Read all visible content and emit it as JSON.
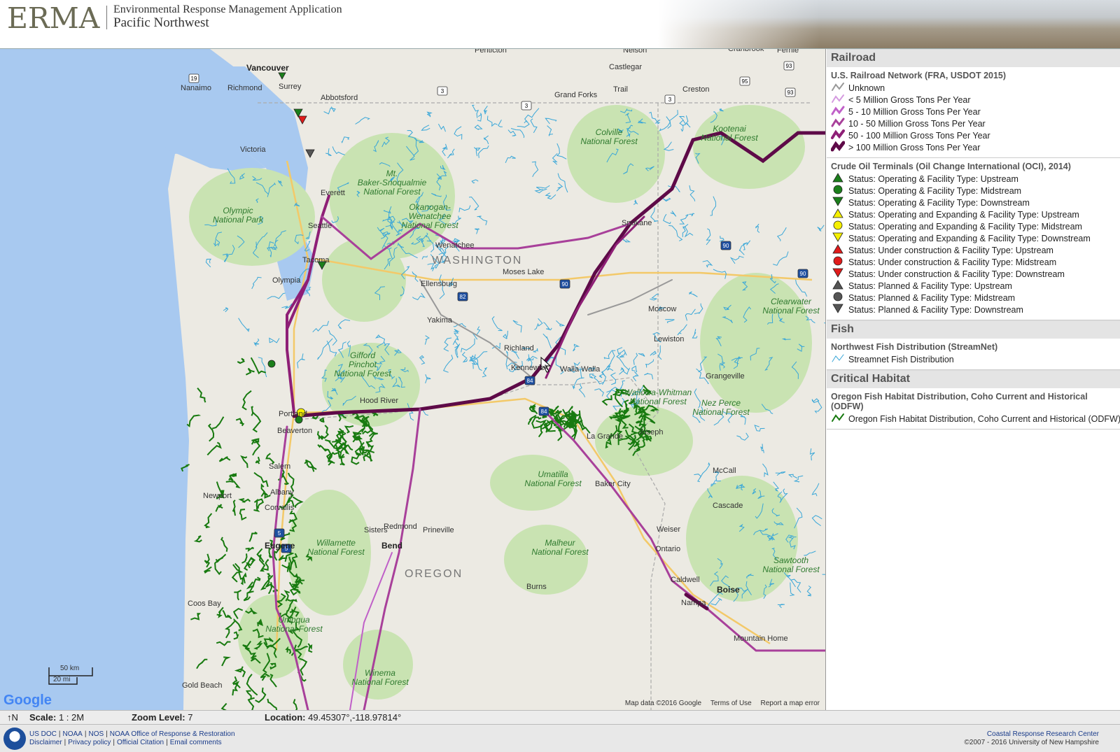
{
  "header": {
    "logo": "ERMA",
    "title": "Environmental Response Management Application",
    "region": "Pacific Northwest"
  },
  "map": {
    "places": [
      {
        "label": "Vancouver",
        "cls": "city",
        "key": "vancouver"
      },
      {
        "label": "Nanaimo",
        "cls": "place",
        "key": "nanaimo"
      },
      {
        "label": "Richmond",
        "cls": "place",
        "key": "richmond"
      },
      {
        "label": "Surrey",
        "cls": "place",
        "key": "surrey"
      },
      {
        "label": "Abbotsford",
        "cls": "place",
        "key": "abbotsford"
      },
      {
        "label": "Victoria",
        "cls": "place",
        "key": "victoria"
      },
      {
        "label": "Penticton",
        "cls": "place",
        "key": "penticton"
      },
      {
        "label": "Nelson",
        "cls": "place",
        "key": "nelson"
      },
      {
        "label": "Castlegar",
        "cls": "place",
        "key": "castlegar"
      },
      {
        "label": "Cranbrook",
        "cls": "place",
        "key": "cranbrook"
      },
      {
        "label": "Fernie",
        "cls": "place",
        "key": "fernie"
      },
      {
        "label": "Grand Forks",
        "cls": "place",
        "key": "grandforks"
      },
      {
        "label": "Trail",
        "cls": "place",
        "key": "trail"
      },
      {
        "label": "Creston",
        "cls": "place",
        "key": "creston"
      },
      {
        "label": "Everett",
        "cls": "place",
        "key": "everett"
      },
      {
        "label": "Seattle",
        "cls": "place",
        "key": "seattle"
      },
      {
        "label": "Tacoma",
        "cls": "place",
        "key": "tacoma"
      },
      {
        "label": "Olympia",
        "cls": "place",
        "key": "olympia"
      },
      {
        "label": "Wenatchee",
        "cls": "place",
        "key": "wenatchee"
      },
      {
        "label": "Moses Lake",
        "cls": "place",
        "key": "moseslake"
      },
      {
        "label": "Ellensburg",
        "cls": "place",
        "key": "ellensburg"
      },
      {
        "label": "Yakima",
        "cls": "place",
        "key": "yakima"
      },
      {
        "label": "Spokane",
        "cls": "place",
        "key": "spokane"
      },
      {
        "label": "Moscow",
        "cls": "place",
        "key": "moscow"
      },
      {
        "label": "Lewiston",
        "cls": "place",
        "key": "lewiston"
      },
      {
        "label": "Richland",
        "cls": "place",
        "key": "richland"
      },
      {
        "label": "Kennewick",
        "cls": "place",
        "key": "kennewick"
      },
      {
        "label": "Walla Walla",
        "cls": "place",
        "key": "wallawalla"
      },
      {
        "label": "Grangeville",
        "cls": "place",
        "key": "grangeville"
      },
      {
        "label": "Hood River",
        "cls": "place",
        "key": "hoodriver"
      },
      {
        "label": "Portland",
        "cls": "place",
        "key": "portland"
      },
      {
        "label": "Beaverton",
        "cls": "place",
        "key": "beaverton"
      },
      {
        "label": "Salem",
        "cls": "place",
        "key": "salem"
      },
      {
        "label": "Albany",
        "cls": "place",
        "key": "albany"
      },
      {
        "label": "Corvallis",
        "cls": "place",
        "key": "corvallis"
      },
      {
        "label": "Newport",
        "cls": "place",
        "key": "newport"
      },
      {
        "label": "La Grande",
        "cls": "place",
        "key": "lagrande"
      },
      {
        "label": "Joseph",
        "cls": "place",
        "key": "joseph"
      },
      {
        "label": "Baker City",
        "cls": "place",
        "key": "bakercity"
      },
      {
        "label": "McCall",
        "cls": "place",
        "key": "mccall"
      },
      {
        "label": "Cascade",
        "cls": "place",
        "key": "cascade"
      },
      {
        "label": "Sisters",
        "cls": "place",
        "key": "sisters"
      },
      {
        "label": "Redmond",
        "cls": "place",
        "key": "redmond"
      },
      {
        "label": "Prineville",
        "cls": "place",
        "key": "prineville"
      },
      {
        "label": "Bend",
        "cls": "city",
        "key": "bend"
      },
      {
        "label": "Eugene",
        "cls": "city",
        "key": "eugene"
      },
      {
        "label": "Weiser",
        "cls": "place",
        "key": "weiser"
      },
      {
        "label": "Ontario",
        "cls": "place",
        "key": "ontario"
      },
      {
        "label": "Caldwell",
        "cls": "place",
        "key": "caldwell"
      },
      {
        "label": "Nampa",
        "cls": "place",
        "key": "nampa"
      },
      {
        "label": "Boise",
        "cls": "city",
        "key": "boise"
      },
      {
        "label": "Mountain Home",
        "cls": "place",
        "key": "mountainhome"
      },
      {
        "label": "Burns",
        "cls": "place",
        "key": "burns"
      },
      {
        "label": "Coos Bay",
        "cls": "place",
        "key": "coosbay"
      },
      {
        "label": "Gold Beach",
        "cls": "place",
        "key": "goldbeach"
      }
    ],
    "parks": [
      {
        "label": "Olympic\nNational Park",
        "key": "olympic"
      },
      {
        "label": "Mt.\nBaker-Snoqualmie\nNational Forest",
        "key": "baker"
      },
      {
        "label": "Okanogan-Wenatchee\nNational Forest",
        "key": "okanogan"
      },
      {
        "label": "Colville\nNational Forest",
        "key": "colville"
      },
      {
        "label": "Kootenai\nNational Forest",
        "key": "kootenai"
      },
      {
        "label": "Gifford\nPinchot\nNational Forest",
        "key": "gifford"
      },
      {
        "label": "Umatilla\nNational Forest",
        "key": "umatilla"
      },
      {
        "label": "Wallowa-Whitman\nNational Forest",
        "key": "wallowa"
      },
      {
        "label": "Willamette\nNational Forest",
        "key": "willamette"
      },
      {
        "label": "Malheur\nNational Forest",
        "key": "malheur"
      },
      {
        "label": "Winema\nNational Forest",
        "key": "winema"
      },
      {
        "label": "Umpqua\nNational Forest",
        "key": "umpqua"
      },
      {
        "label": "Nez Perce\nNational Forest",
        "key": "nezperce"
      },
      {
        "label": "Clearwater\nNational Forest",
        "key": "clearwater"
      },
      {
        "label": "Sawtooth\nNational Forest",
        "key": "sawtooth"
      }
    ],
    "states": [
      "WASHINGTON",
      "OREGON"
    ],
    "highway_shields": [
      "19",
      "3",
      "3",
      "3",
      "95",
      "93",
      "93",
      "90",
      "90",
      "90",
      "82",
      "84",
      "84",
      "5",
      "5"
    ],
    "google_logo": "Google",
    "scale_km": "50 km",
    "scale_mi": "20 mi",
    "attribution": [
      "Map data ©2016 Google",
      "Terms of Use",
      "Report a map error"
    ]
  },
  "legend": {
    "sections": [
      {
        "heading": "Railroad",
        "layer": "U.S. Railroad Network (FRA, USDOT 2015)",
        "items": [
          {
            "label": "Unknown",
            "sym": "rail",
            "color": "#999999",
            "w": 2
          },
          {
            "label": "< 5 Million Gross Tons Per Year",
            "sym": "rail",
            "color": "#d59be0",
            "w": 2
          },
          {
            "label": "5 - 10 Million Gross Tons Per Year",
            "sym": "rail",
            "color": "#c060c8",
            "w": 3
          },
          {
            "label": "10 - 50 Million Gross Tons Per Year",
            "sym": "rail",
            "color": "#a8409a",
            "w": 3
          },
          {
            "label": "50 - 100 Million Gross Tons Per Year",
            "sym": "rail",
            "color": "#8e1f76",
            "w": 4
          },
          {
            "label": "> 100 Million Gross Tons Per Year",
            "sym": "rail",
            "color": "#5e0a48",
            "w": 5
          }
        ]
      },
      {
        "heading": "",
        "layer": "Crude Oil Terminals (Oil Change International (OCI), 2014)",
        "items": [
          {
            "label": "Status: Operating & Facility Type: Upstream",
            "sym": "up",
            "color": "#1b7f1b"
          },
          {
            "label": "Status: Operating & Facility Type: Midstream",
            "sym": "mid",
            "color": "#1b7f1b"
          },
          {
            "label": "Status: Operating & Facility Type: Downstream",
            "sym": "down",
            "color": "#1b7f1b"
          },
          {
            "label": "Status: Operating and Expanding & Facility Type: Upstream",
            "sym": "up",
            "color": "#f5ef00"
          },
          {
            "label": "Status: Operating and Expanding & Facility Type: Midstream",
            "sym": "mid",
            "color": "#f5ef00"
          },
          {
            "label": "Status: Operating and Expanding & Facility Type: Downstream",
            "sym": "down",
            "color": "#f5ef00"
          },
          {
            "label": "Status: Under construction & Facility Type: Upstream",
            "sym": "up",
            "color": "#e11b1b"
          },
          {
            "label": "Status: Under construction & Facility Type: Midstream",
            "sym": "mid",
            "color": "#e11b1b"
          },
          {
            "label": "Status: Under construction & Facility Type: Downstream",
            "sym": "down",
            "color": "#e11b1b"
          },
          {
            "label": "Status: Planned & Facility Type: Upstream",
            "sym": "up",
            "color": "#555555"
          },
          {
            "label": "Status: Planned & Facility Type: Midstream",
            "sym": "mid",
            "color": "#555555"
          },
          {
            "label": "Status: Planned & Facility Type: Downstream",
            "sym": "down",
            "color": "#555555"
          }
        ]
      },
      {
        "heading": "Fish",
        "layer": "Northwest Fish Distribution (StreamNet)",
        "items": [
          {
            "label": "Streamnet Fish Distribution",
            "sym": "line",
            "color": "#3aa7d8",
            "w": 1
          }
        ]
      },
      {
        "heading": "Critical Habitat",
        "layer": "Oregon Fish Habitat Distribution, Coho Current and Historical (ODFW)",
        "items": [
          {
            "label": "Oregon Fish Habitat Distribution, Coho Current and Historical (ODFW)",
            "sym": "line",
            "color": "#187a10",
            "w": 2
          }
        ]
      }
    ]
  },
  "status": {
    "north": "↑N",
    "scale_label": "Scale:",
    "scale_value": "1 : 2M",
    "zoom_label": "Zoom Level:",
    "zoom_value": "7",
    "location_label": "Location:",
    "location_value": "49.45307°,-118.97814°"
  },
  "footer": {
    "links1": [
      "US DOC",
      "NOAA",
      "NOS",
      "NOAA Office of Response & Restoration"
    ],
    "links2": [
      "Disclaimer",
      "Privacy policy",
      "Official Citation",
      "Email comments"
    ],
    "right1": "Coastal Response Research Center",
    "right2": "©2007 - 2016 University of New Hampshire"
  }
}
